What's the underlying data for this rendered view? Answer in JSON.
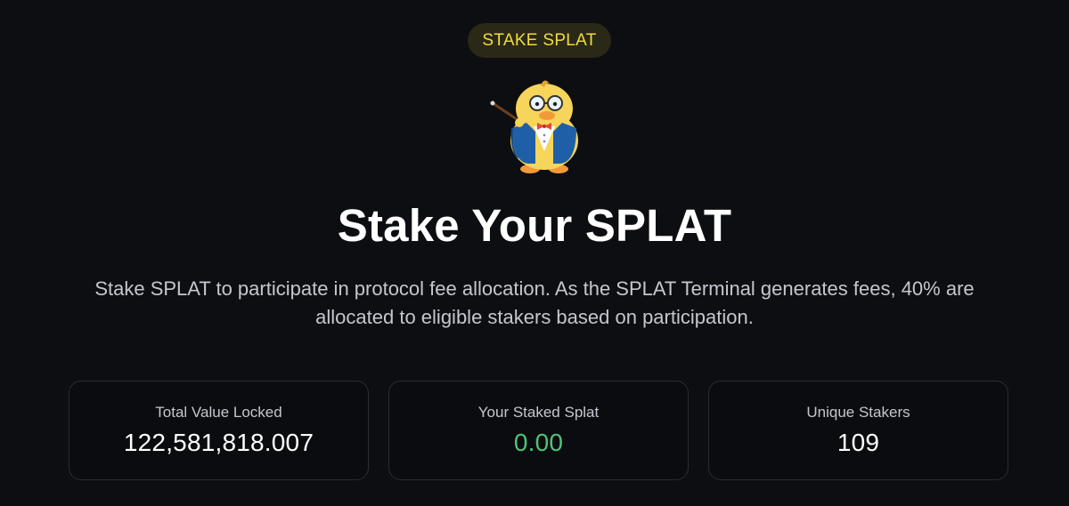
{
  "badge": {
    "label": "STAKE SPLAT",
    "color": "#f2dc3f"
  },
  "mascot": {
    "icon": "duck-professor-mascot-icon"
  },
  "heading": {
    "title": "Stake Your SPLAT"
  },
  "description": {
    "text": "Stake SPLAT to participate in protocol fee allocation. As the SPLAT Terminal generates fees, 40% are allocated to eligible stakers based on participation."
  },
  "stats": [
    {
      "label": "Total Value Locked",
      "value": "122,581,818.007"
    },
    {
      "label": "Your Staked Splat",
      "value": "0.00",
      "value_color": "#4cc47a"
    },
    {
      "label": "Unique Stakers",
      "value": "109"
    }
  ]
}
